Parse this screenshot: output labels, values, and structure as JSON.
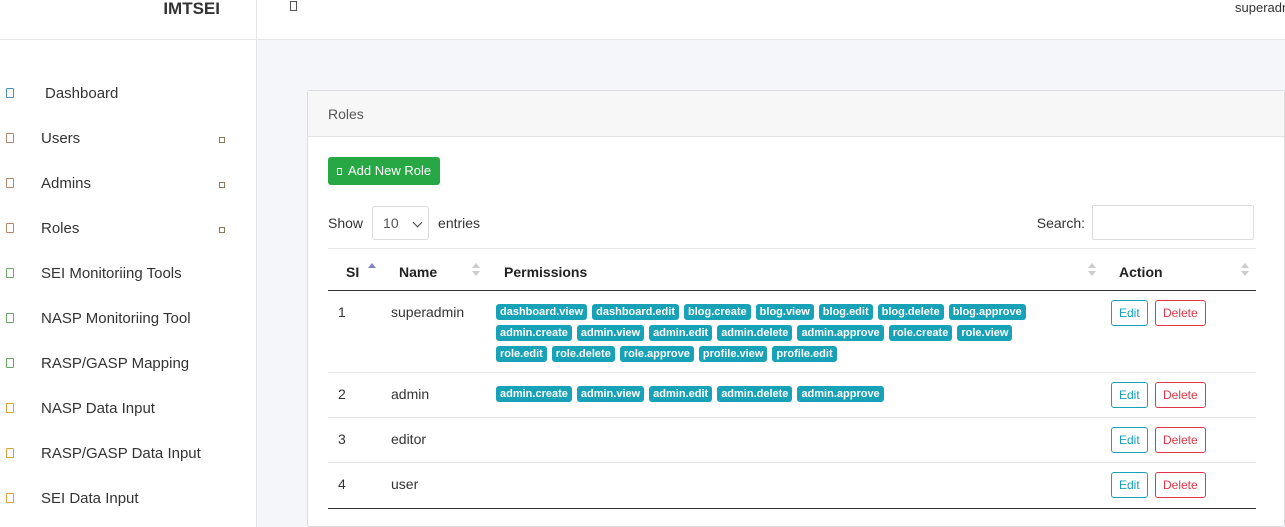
{
  "brand": "IMTSEI",
  "topbar": {
    "user": "superadmin"
  },
  "sidebar": {
    "items": [
      {
        "label": "Dashboard",
        "has_caret": false,
        "color": "#4a90c4"
      },
      {
        "label": "Users",
        "has_caret": true,
        "color": "#b8866b"
      },
      {
        "label": "Admins",
        "has_caret": true,
        "color": "#b8866b"
      },
      {
        "label": "Roles",
        "has_caret": true,
        "color": "#b8866b"
      },
      {
        "label": "SEI Monitoriing Tools",
        "has_caret": false,
        "color": "#6aa86a"
      },
      {
        "label": "NASP Monitoriing Tool",
        "has_caret": false,
        "color": "#6aa86a"
      },
      {
        "label": "RASP/GASP Mapping",
        "has_caret": false,
        "color": "#6aa86a"
      },
      {
        "label": "NASP Data Input",
        "has_caret": false,
        "color": "#e0a040"
      },
      {
        "label": "RASP/GASP Data Input",
        "has_caret": false,
        "color": "#e0a040"
      },
      {
        "label": "SEI Data Input",
        "has_caret": false,
        "color": "#e0a040"
      }
    ]
  },
  "card": {
    "title": "Roles",
    "add_button": "Add New Role",
    "show_label": "Show",
    "entries_value": "10",
    "entries_label": "entries",
    "search_label": "Search:"
  },
  "table": {
    "columns": [
      "SI",
      "Name",
      "Permissions",
      "Action"
    ],
    "rows": [
      {
        "si": "1",
        "name": "superadmin",
        "permissions": [
          "dashboard.view",
          "dashboard.edit",
          "blog.create",
          "blog.view",
          "blog.edit",
          "blog.delete",
          "blog.approve",
          "admin.create",
          "admin.view",
          "admin.edit",
          "admin.delete",
          "admin.approve",
          "role.create",
          "role.view",
          "role.edit",
          "role.delete",
          "role.approve",
          "profile.view",
          "profile.edit"
        ]
      },
      {
        "si": "2",
        "name": "admin",
        "permissions": [
          "admin.create",
          "admin.view",
          "admin.edit",
          "admin.delete",
          "admin.approve"
        ]
      },
      {
        "si": "3",
        "name": "editor",
        "permissions": []
      },
      {
        "si": "4",
        "name": "user",
        "permissions": []
      }
    ],
    "edit_label": "Edit",
    "delete_label": "Delete"
  }
}
